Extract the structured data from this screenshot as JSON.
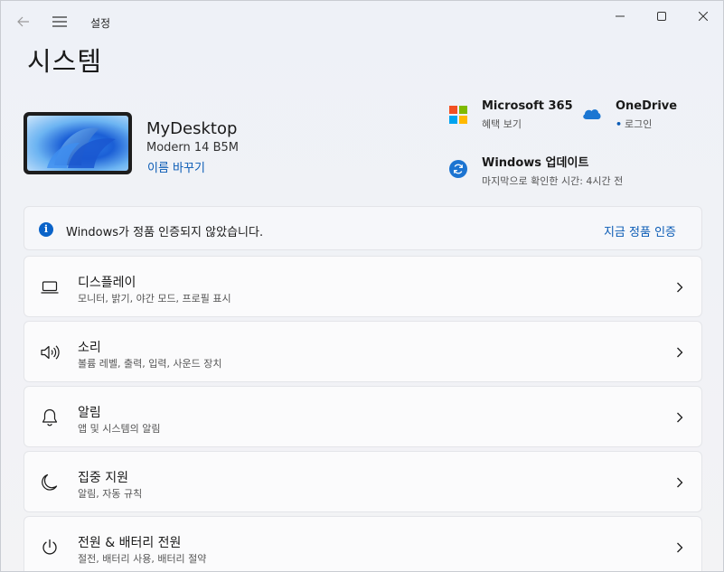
{
  "titlebar": {
    "app_title": "설정",
    "controls": {
      "minimize": "minimize",
      "maximize": "maximize",
      "close": "close"
    }
  },
  "page": {
    "title": "시스템"
  },
  "device": {
    "name": "MyDesktop",
    "model": "Modern 14 B5M",
    "rename_link": "이름 바꾸기"
  },
  "quick_links": {
    "microsoft365": {
      "title": "Microsoft 365",
      "subtitle": "혜택 보기",
      "icon": "microsoft-logo-icon"
    },
    "onedrive": {
      "title": "OneDrive",
      "subtitle": "로그인",
      "icon": "onedrive-cloud-icon"
    },
    "windows_update": {
      "title": "Windows 업데이트",
      "subtitle": "마지막으로 확인한 시간: 4시간 전",
      "icon": "windows-update-icon"
    }
  },
  "notice": {
    "text": "Windows가 정품 인증되지 않았습니다.",
    "action": "지금 정품 인증",
    "icon": "info-icon"
  },
  "settings": [
    {
      "title": "디스플레이",
      "subtitle": "모니터, 밝기, 야간 모드, 프로필 표시",
      "icon": "display-icon"
    },
    {
      "title": "소리",
      "subtitle": "볼륨 레벨, 출력, 입력, 사운드 장치",
      "icon": "speaker-icon"
    },
    {
      "title": "알림",
      "subtitle": "앱 및 시스템의 알림",
      "icon": "bell-icon"
    },
    {
      "title": "집중 지원",
      "subtitle": "알림, 자동 규칙",
      "icon": "moon-icon"
    },
    {
      "title": "전원 & 배터리 전원",
      "subtitle": "절전, 배터리 사용, 배터리 절약",
      "icon": "power-icon"
    }
  ],
  "colors": {
    "accent": "#0a5bb5",
    "ms_red": "#f25022",
    "ms_green": "#7fba00",
    "ms_blue": "#00a4ef",
    "ms_yellow": "#ffb900",
    "onedrive_blue": "#1b76d2"
  }
}
